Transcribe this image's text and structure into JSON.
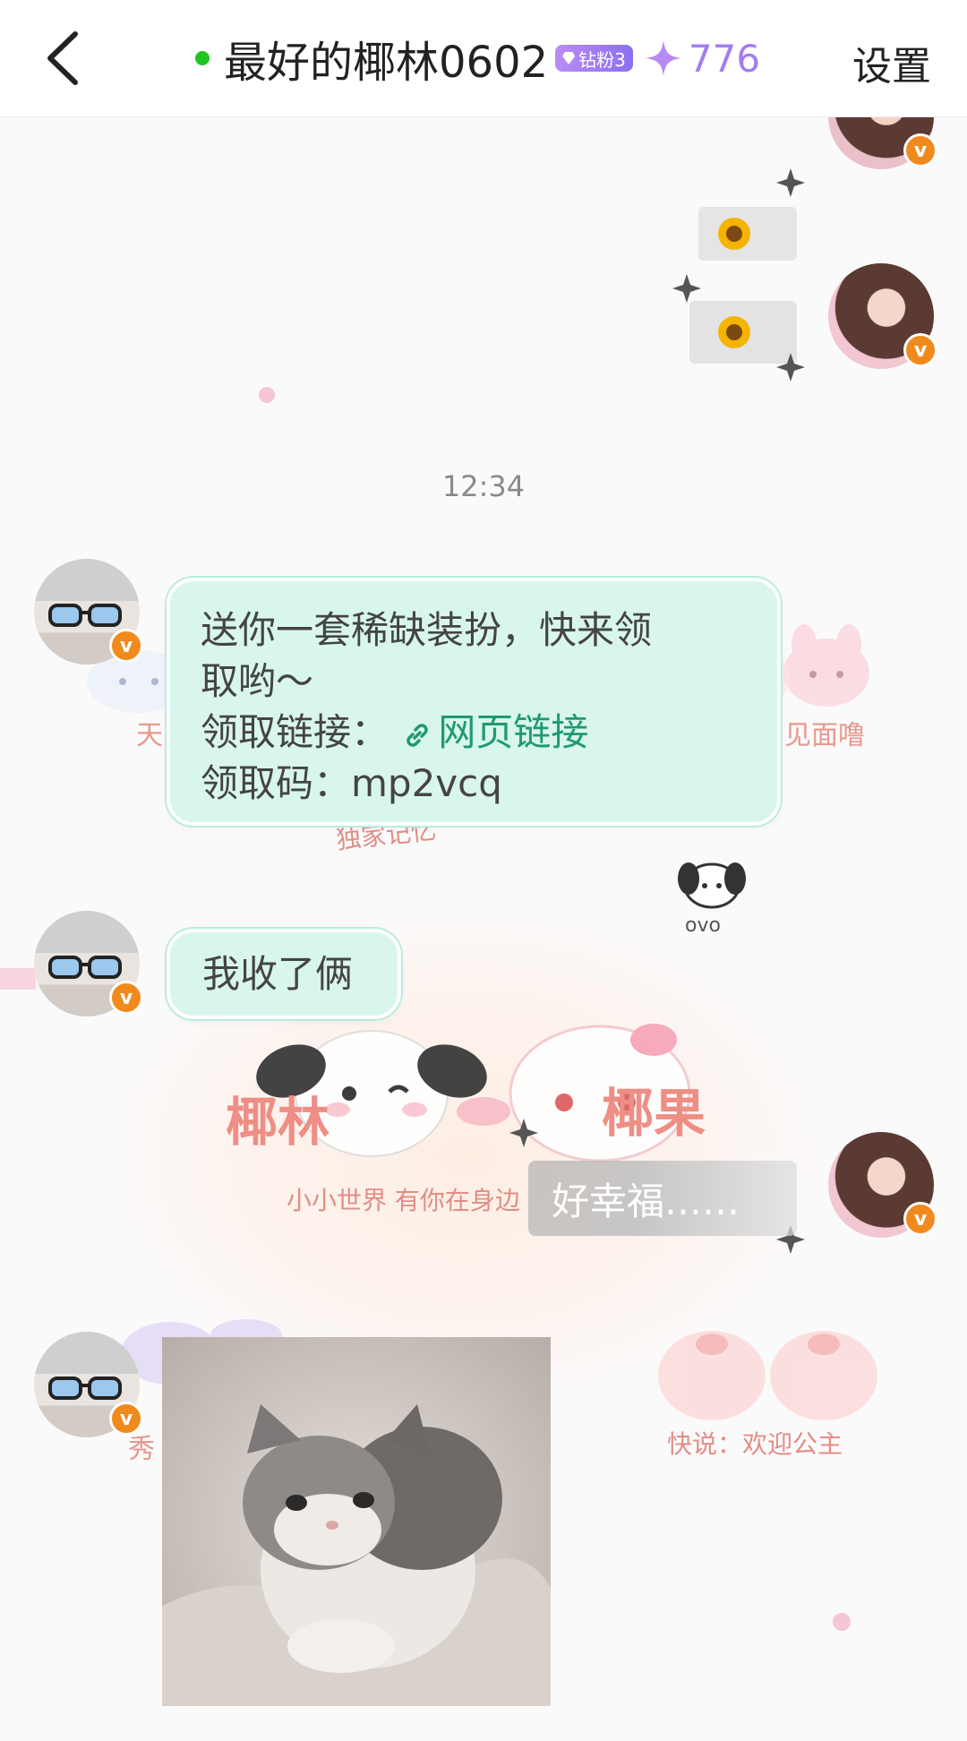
{
  "header": {
    "back_icon": "chevron-left-icon",
    "title": "最好的椰林0602",
    "fan_badge": "钻粉3",
    "score": "776",
    "settings_label": "设置",
    "online_color": "#22c322",
    "accent_color": "#a37cf0"
  },
  "chat": {
    "timestamp": "12:34",
    "messages": [
      {
        "side": "left",
        "lines": [
          "送你一套稀缺装扮，快来领",
          "取哟～"
        ],
        "link_prefix": "领取链接：",
        "link_text": "网页链接",
        "code_line": "领取码：mp2vcq"
      },
      {
        "side": "left",
        "text": "我收了俩"
      },
      {
        "side": "right",
        "text": "好幸福……"
      }
    ],
    "decor_texts": {
      "name_left": "椰林",
      "name_right": "椰果",
      "caption_small": "小小世界 有你在身边",
      "memory": "独家记忆",
      "ovo": "ovo",
      "meet": "见面噜",
      "kuai": "快说：欢迎公主",
      "tian": "天",
      "xiu": "秀"
    }
  }
}
